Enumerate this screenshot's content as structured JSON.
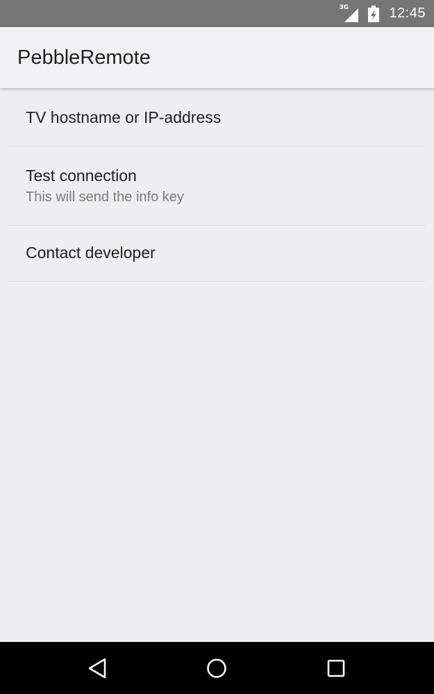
{
  "status_bar": {
    "network_label": "3G",
    "time": "12:45",
    "icons": [
      "signal-icon",
      "battery-icon"
    ]
  },
  "app_bar": {
    "title": "PebbleRemote"
  },
  "preferences": [
    {
      "title": "TV hostname or IP-address"
    },
    {
      "title": "Test connection",
      "summary": "This will send the info key"
    },
    {
      "title": "Contact developer"
    }
  ],
  "nav_bar": {
    "icons": [
      "back-icon",
      "home-icon",
      "recents-icon"
    ]
  },
  "colors": {
    "status_bar": "#757575",
    "app_bar": "#f1f0f2",
    "background": "#eeedef",
    "nav_bar": "#000000",
    "primary_text": "#212121",
    "secondary_text": "#7b7b7b",
    "divider": "#d8d7d9"
  }
}
